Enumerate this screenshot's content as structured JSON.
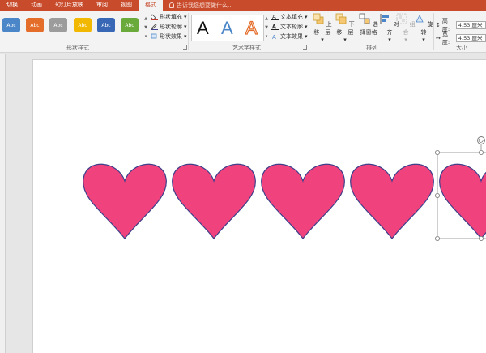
{
  "tabs": [
    {
      "label": "切换",
      "active": false
    },
    {
      "label": "动画",
      "active": false
    },
    {
      "label": "幻灯片放映",
      "active": false
    },
    {
      "label": "审阅",
      "active": false
    },
    {
      "label": "视图",
      "active": false
    },
    {
      "label": "格式",
      "active": true
    }
  ],
  "tell_me": "告诉我您想要做什么...",
  "shape_styles": {
    "label": "形状样式",
    "swatches": [
      {
        "text": "Abc",
        "color": "#4a86c8"
      },
      {
        "text": "Abc",
        "color": "#e56d2a"
      },
      {
        "text": "Abc",
        "color": "#9c9c9c"
      },
      {
        "text": "Abc",
        "color": "#f2b800"
      },
      {
        "text": "Abc",
        "color": "#3867b6"
      },
      {
        "text": "Abc",
        "color": "#6aaa3a"
      }
    ],
    "fill": "形状填充",
    "outline": "形状轮廓",
    "effects": "形状效果"
  },
  "wordart": {
    "label": "艺术字样式",
    "letters": [
      "A",
      "A",
      "A"
    ],
    "text_fill": "文本填充",
    "text_outline": "文本轮廓",
    "text_effects": "文本效果"
  },
  "arrange": {
    "label": "排列",
    "bring_forward": "上移一层",
    "send_backward": "下移一层",
    "selection_pane": "选择窗格",
    "align": "对齐",
    "group": "组合",
    "rotate": "旋转"
  },
  "size": {
    "label": "大小",
    "height_label": "高度:",
    "height_value": "4.53 厘米",
    "width_label": "宽度:",
    "width_value": "4.53 厘米"
  },
  "hearts": {
    "fill_color": "#f0437e",
    "stroke_color": "#3f3f8a",
    "count": 5
  }
}
